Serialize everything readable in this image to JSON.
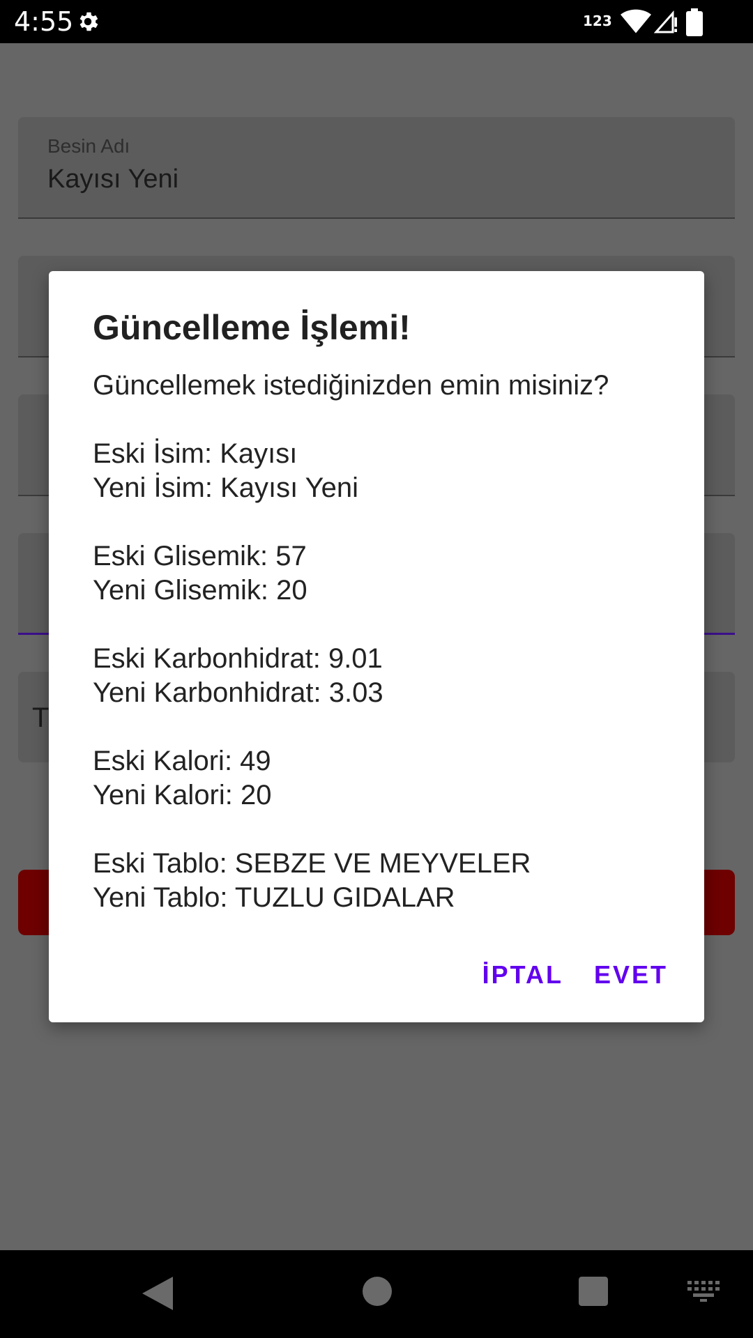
{
  "status_bar": {
    "time": "4:55",
    "indicator": "123",
    "icons": [
      "settings-gear-icon",
      "wifi-icon",
      "signal-icon",
      "battery-icon"
    ]
  },
  "form": {
    "name_field": {
      "label": "Besin Adı",
      "value": "Kayısı Yeni"
    },
    "table_field": {
      "value": "T"
    }
  },
  "dialog": {
    "title": "Güncelleme İşlemi!",
    "question": "Güncellemek istediğinizden emin misiniz?",
    "groups": [
      [
        "Eski İsim: Kayısı",
        "Yeni İsim: Kayısı Yeni"
      ],
      [
        "Eski Glisemik: 57",
        "Yeni Glisemik: 20"
      ],
      [
        "Eski Karbonhidrat: 9.01",
        "Yeni Karbonhidrat: 3.03"
      ],
      [
        "Eski Kalori: 49",
        "Yeni Kalori: 20"
      ],
      [
        "Eski Tablo: SEBZE VE MEYVELER",
        "Yeni Tablo: TUZLU GIDALAR"
      ]
    ],
    "cancel_label": "İPTAL",
    "confirm_label": "EVET"
  },
  "colors": {
    "accent": "#6200ee",
    "scrim_background": "#666666",
    "danger_button": "#6e0000"
  },
  "nav_bar": {
    "icons": [
      "back-icon",
      "home-icon",
      "recents-icon",
      "keyboard-icon"
    ]
  }
}
